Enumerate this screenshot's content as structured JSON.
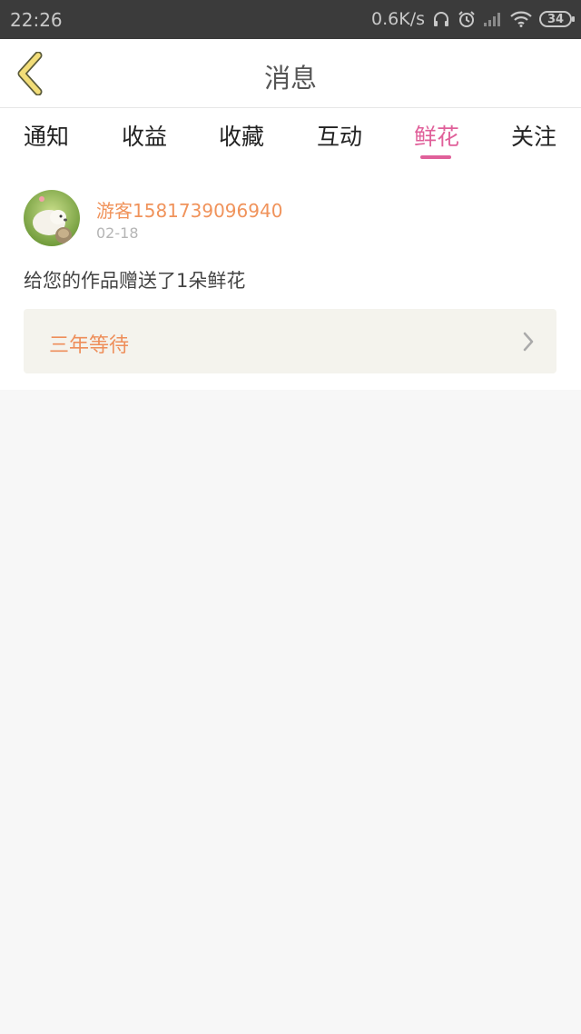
{
  "status_bar": {
    "time": "22:26",
    "net_speed": "0.6K/s",
    "battery": "34",
    "icons": [
      "headphones-icon",
      "alarm-icon",
      "signal-icon",
      "wifi-icon",
      "battery-icon"
    ]
  },
  "header": {
    "title": "消息",
    "back_icon": "chevron-left-icon"
  },
  "tabs": {
    "items": [
      {
        "label": "通知"
      },
      {
        "label": "收益"
      },
      {
        "label": "收藏"
      },
      {
        "label": "互动"
      },
      {
        "label": "鲜花"
      },
      {
        "label": "关注"
      }
    ],
    "active": "鲜花"
  },
  "message": {
    "username": "游客1581739096940",
    "date": "02-18",
    "text": "给您的作品赠送了1朵鲜花",
    "work_title": "三年等待"
  },
  "colors": {
    "accent_pink": "#e0609a",
    "accent_orange": "#f0935b",
    "back_icon": "#f2dd78",
    "page_bg": "#f7f7f7",
    "card_bg": "#f4f3ed"
  }
}
